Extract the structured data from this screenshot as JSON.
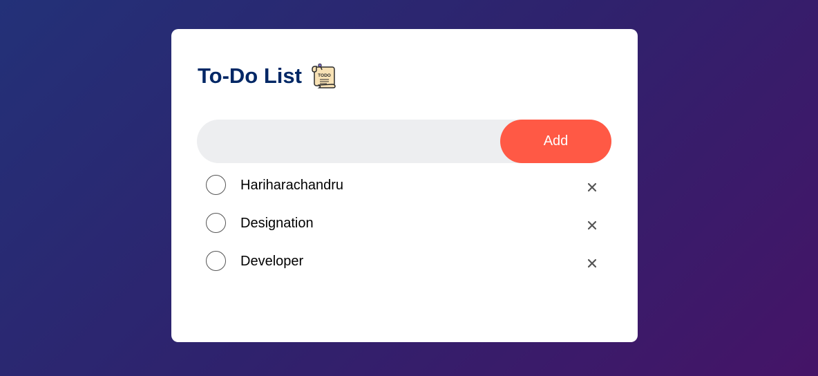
{
  "header": {
    "title": "To-Do List",
    "logo_icon": "todo-note-icon",
    "logo_text": "TODO"
  },
  "input": {
    "value": "",
    "placeholder": ""
  },
  "add_button": {
    "label": "Add"
  },
  "tasks": [
    {
      "label": "Hariharachandru",
      "checked": false
    },
    {
      "label": "Designation",
      "checked": false
    },
    {
      "label": "Developer",
      "checked": false
    }
  ],
  "colors": {
    "title": "#002765",
    "accent": "#ff5945",
    "input_bg": "#edeef0",
    "background_start": "#233178",
    "background_end": "#451467"
  }
}
